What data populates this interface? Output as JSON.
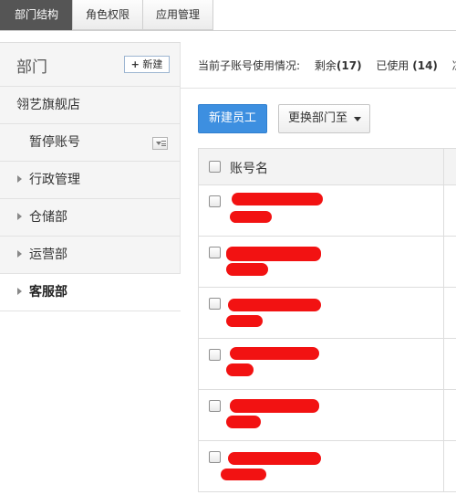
{
  "tabs": [
    {
      "label": "部门结构",
      "active": true
    },
    {
      "label": "角色权限",
      "active": false
    },
    {
      "label": "应用管理",
      "active": false
    }
  ],
  "sidebar": {
    "title": "部门",
    "new_button_plus": "+",
    "new_button_label": "新建",
    "items": [
      {
        "label": "翎艺旗舰店",
        "type": "root"
      },
      {
        "label": "暂停账号",
        "type": "child"
      },
      {
        "label": "行政管理",
        "type": "dept"
      },
      {
        "label": "仓储部",
        "type": "dept"
      },
      {
        "label": "运营部",
        "type": "dept"
      },
      {
        "label": "客服部",
        "type": "dept",
        "active": true
      }
    ]
  },
  "main": {
    "usage_label": "当前子账号使用情况:",
    "remaining_label": "剩余",
    "remaining_value": "(17)",
    "used_label": "已使用",
    "used_value": "(14)",
    "cut_label": "冻",
    "new_employee_button": "新建员工",
    "change_dept_button": "更换部门至"
  },
  "table": {
    "header": "账号名",
    "rows": [
      {
        "name": "",
        "sub": ""
      },
      {
        "name": "",
        "sub": ""
      },
      {
        "name": "",
        "sub": ""
      },
      {
        "name": "",
        "sub": ""
      },
      {
        "name": "",
        "sub": ""
      },
      {
        "name": "",
        "sub": ""
      }
    ]
  },
  "colors": {
    "primary_button": "#3d8fe0",
    "active_tab": "#555555",
    "link": "#3b73b9",
    "redaction": "#f21212"
  }
}
